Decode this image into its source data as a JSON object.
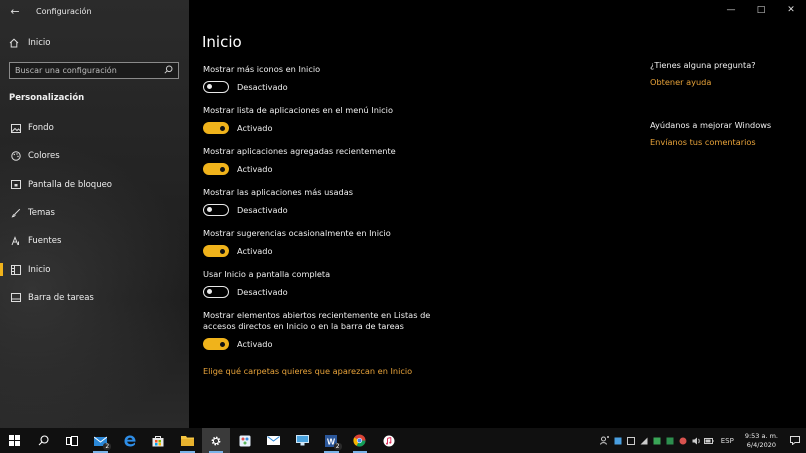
{
  "window": {
    "title": "Configuración",
    "controls": {
      "minimize": "—",
      "maximize": "□",
      "close": "✕"
    }
  },
  "sidebar": {
    "home_label": "Inicio",
    "search_placeholder": "Buscar una configuración",
    "section_title": "Personalización",
    "items": [
      {
        "label": "Fondo",
        "icon": "image-icon",
        "active": false
      },
      {
        "label": "Colores",
        "icon": "palette-icon",
        "active": false
      },
      {
        "label": "Pantalla de bloqueo",
        "icon": "lock-screen-icon",
        "active": false
      },
      {
        "label": "Temas",
        "icon": "brush-icon",
        "active": false
      },
      {
        "label": "Fuentes",
        "icon": "font-icon",
        "active": false
      },
      {
        "label": "Inicio",
        "icon": "start-icon",
        "active": true
      },
      {
        "label": "Barra de tareas",
        "icon": "taskbar-icon",
        "active": false
      }
    ]
  },
  "main": {
    "title": "Inicio",
    "settings": [
      {
        "title": "Mostrar más iconos en Inicio",
        "on": false,
        "state": "Desactivado"
      },
      {
        "title": "Mostrar lista de aplicaciones en el menú Inicio",
        "on": true,
        "state": "Activado"
      },
      {
        "title": "Mostrar aplicaciones agregadas recientemente",
        "on": true,
        "state": "Activado"
      },
      {
        "title": "Mostrar las aplicaciones más usadas",
        "on": false,
        "state": "Desactivado"
      },
      {
        "title": "Mostrar sugerencias ocasionalmente en Inicio",
        "on": true,
        "state": "Activado"
      },
      {
        "title": "Usar Inicio a pantalla completa",
        "on": false,
        "state": "Desactivado"
      },
      {
        "title": "Mostrar elementos abiertos recientemente en Listas de accesos directos en Inicio o en la barra de tareas",
        "on": true,
        "state": "Activado"
      }
    ],
    "folders_link": "Elige qué carpetas quieres que aparezcan en Inicio"
  },
  "side_panel": {
    "question": "¿Tienes alguna pregunta?",
    "help_link": "Obtener ayuda",
    "improve": "Ayúdanos a mejorar Windows",
    "feedback_link": "Envíanos tus comentarios"
  },
  "taskbar": {
    "apps": [
      {
        "name": "windows-start-icon",
        "badge": ""
      },
      {
        "name": "search-icon",
        "badge": ""
      },
      {
        "name": "task-view-icon",
        "badge": ""
      },
      {
        "name": "mail-people-icon",
        "badge": "2"
      },
      {
        "name": "edge-icon",
        "badge": ""
      },
      {
        "name": "store-icon",
        "badge": ""
      },
      {
        "name": "file-explorer-icon",
        "badge": ""
      },
      {
        "name": "settings-icon",
        "badge": ""
      },
      {
        "name": "paint-icon",
        "badge": ""
      },
      {
        "name": "mail-icon",
        "badge": ""
      },
      {
        "name": "network-app-icon",
        "badge": ""
      },
      {
        "name": "word-icon",
        "badge": "2"
      },
      {
        "name": "chrome-icon",
        "badge": ""
      },
      {
        "name": "itunes-icon",
        "badge": ""
      }
    ],
    "language": "ESP",
    "time": "9:53 a. m.",
    "date": "6/4/2020"
  },
  "colors": {
    "accent": "#f0b31b",
    "link": "#e8a33a",
    "background": "#000000",
    "sidebar": "#262626"
  }
}
